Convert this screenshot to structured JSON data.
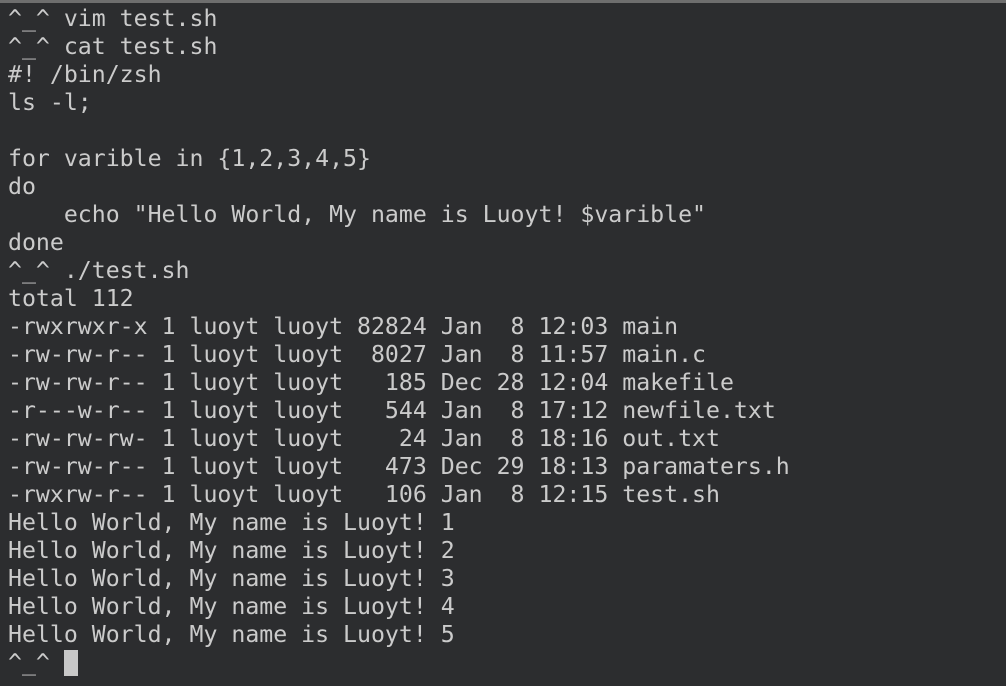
{
  "terminal": {
    "lines": [
      "^_^ vim test.sh",
      "^_^ cat test.sh",
      "#! /bin/zsh",
      "ls -l;",
      "",
      "for varible in {1,2,3,4,5}",
      "do",
      "    echo \"Hello World, My name is Luoyt! $varible\"",
      "done",
      "^_^ ./test.sh",
      "total 112",
      "-rwxrwxr-x 1 luoyt luoyt 82824 Jan  8 12:03 main",
      "-rw-rw-r-- 1 luoyt luoyt  8027 Jan  8 11:57 main.c",
      "-rw-rw-r-- 1 luoyt luoyt   185 Dec 28 12:04 makefile",
      "-r---w-r-- 1 luoyt luoyt   544 Jan  8 17:12 newfile.txt",
      "-rw-rw-rw- 1 luoyt luoyt    24 Jan  8 18:16 out.txt",
      "-rw-rw-r-- 1 luoyt luoyt   473 Dec 29 18:13 paramaters.h",
      "-rwxrw-r-- 1 luoyt luoyt   106 Jan  8 12:15 test.sh",
      "Hello World, My name is Luoyt! 1",
      "Hello World, My name is Luoyt! 2",
      "Hello World, My name is Luoyt! 3",
      "Hello World, My name is Luoyt! 4",
      "Hello World, My name is Luoyt! 5"
    ],
    "prompt": "^_^ "
  },
  "colors": {
    "background": "#2c2d2f",
    "foreground": "#cbcbcb",
    "cursor": "#c8c8c8"
  }
}
